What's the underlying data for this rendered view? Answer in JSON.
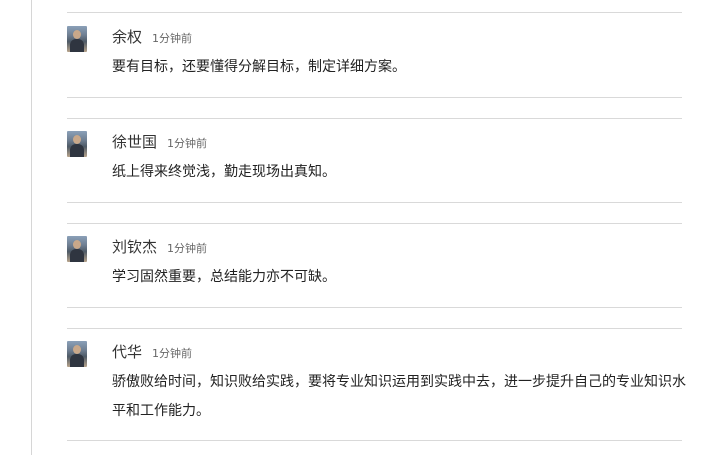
{
  "comments": [
    {
      "author": "余权",
      "time": "1分钟前",
      "content": "要有目标，还要懂得分解目标，制定详细方案。"
    },
    {
      "author": "徐世国",
      "time": "1分钟前",
      "content": "纸上得来终觉浅，勤走现场出真知。"
    },
    {
      "author": "刘钦杰",
      "time": "1分钟前",
      "content": "学习固然重要，总结能力亦不可缺。"
    },
    {
      "author": "代华",
      "time": "1分钟前",
      "content": "骄傲败给时间，知识败给实践，要将专业知识运用到实践中去，进一步提升自己的专业知识水平和工作能力。"
    }
  ]
}
